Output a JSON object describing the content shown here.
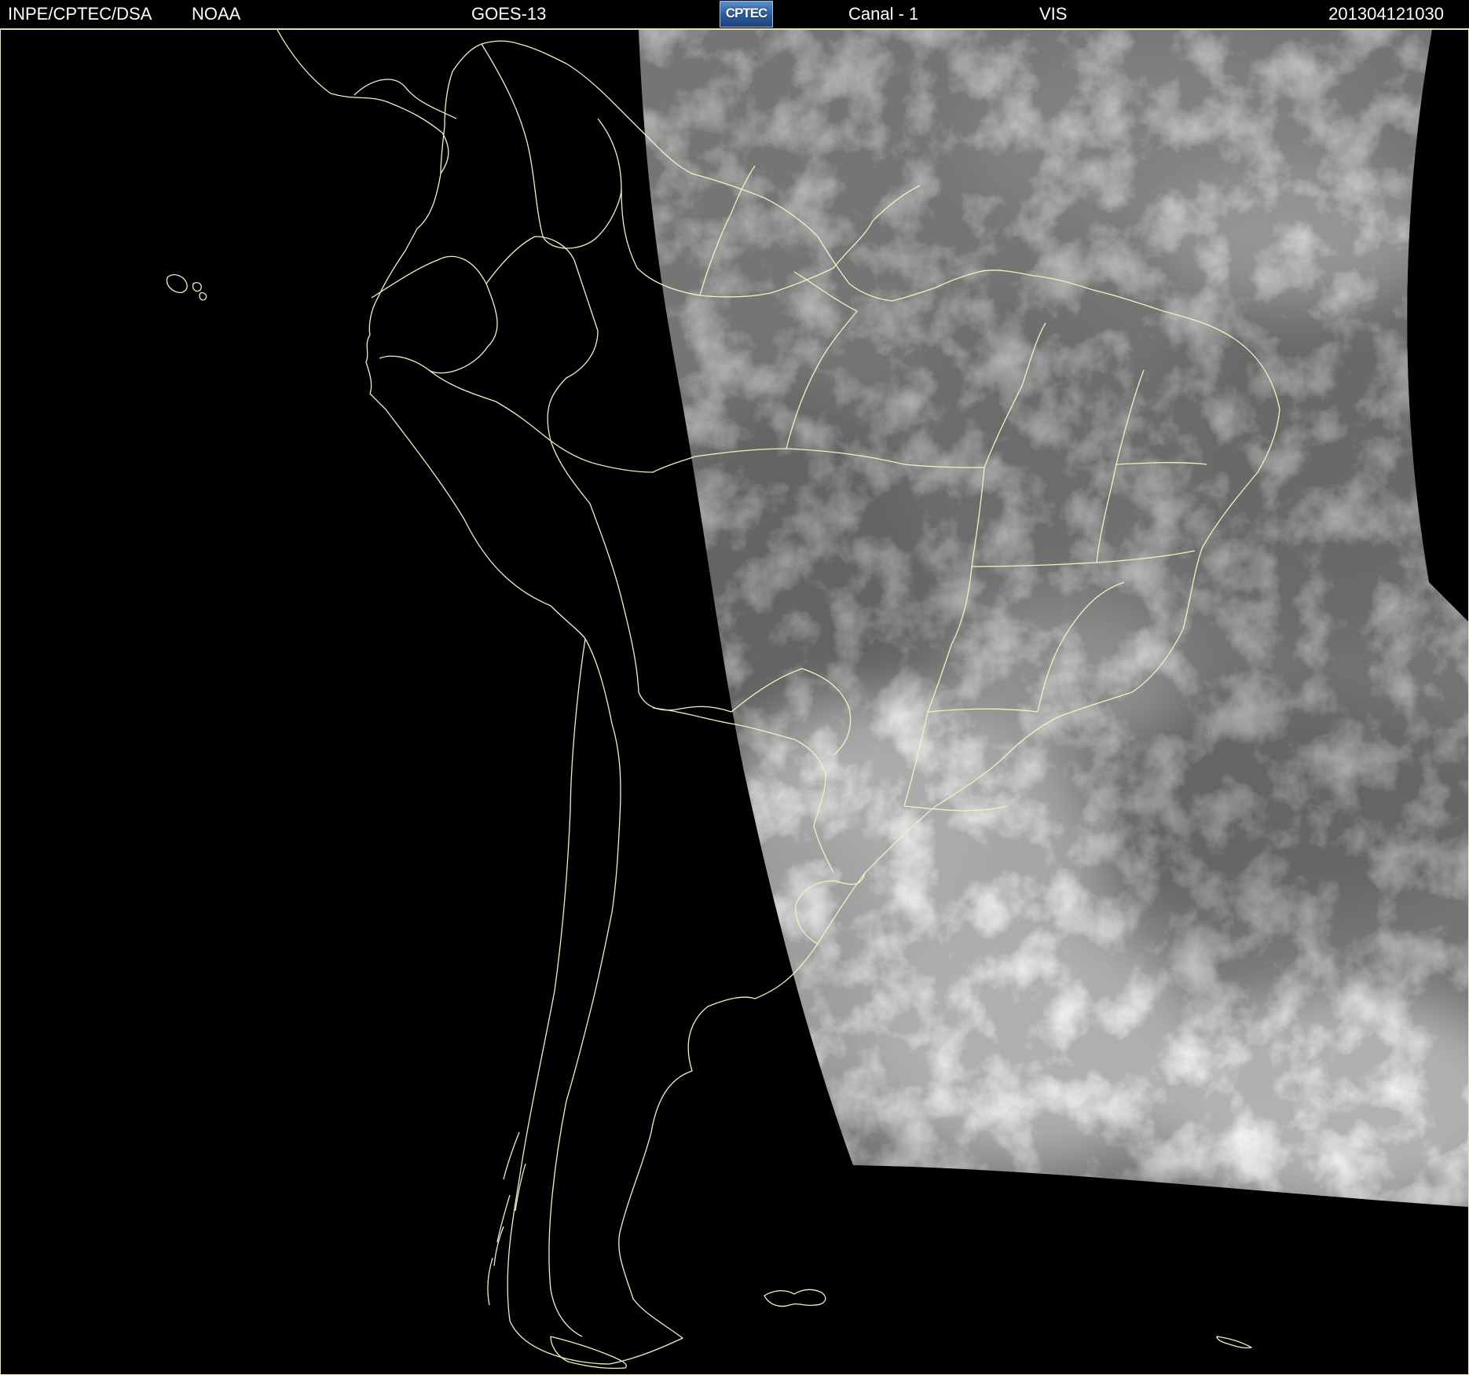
{
  "header": {
    "organization": "INPE/CPTEC/DSA",
    "agency": "NOAA",
    "satellite": "GOES-13",
    "logo_text": "CPTEC",
    "channel": "Canal - 1",
    "band": "VIS",
    "timestamp": "201304121030"
  },
  "map": {
    "region": "South America",
    "imagery": "visible satellite cloud cover",
    "background_color": "#000000",
    "border_color": "#eeeebc"
  }
}
